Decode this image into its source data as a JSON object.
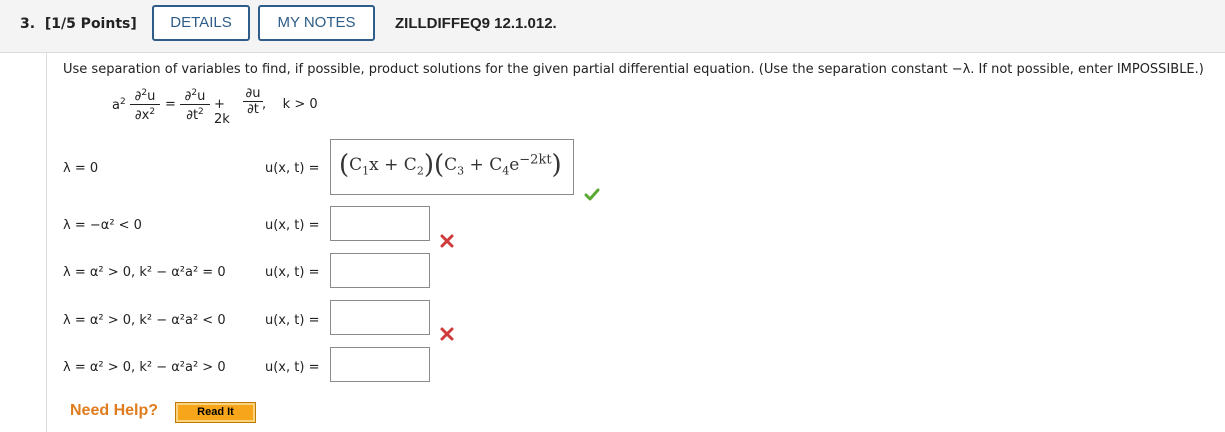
{
  "header": {
    "question_number": "3.",
    "points": "[1/5 Points]",
    "details_label": "DETAILS",
    "notes_label": "MY NOTES",
    "question_id": "ZILLDIFFEQ9 12.1.012."
  },
  "instruction": "Use separation of variables to find, if possible, product solutions for the given partial differential equation. (Use the separation constant −λ. If not possible, enter IMPOSSIBLE.)",
  "pde": {
    "coef": "a",
    "lhs_num": "∂",
    "lhs_u": "u",
    "lhs_den": "∂x",
    "equals": "=",
    "rhs1_num": "∂",
    "rhs1_u": "u",
    "rhs1_den": "∂t",
    "plus_2k": "+ 2k",
    "rhs2_num": "∂u",
    "rhs2_den": "∂t",
    "condition": ",    k > 0"
  },
  "cases": [
    {
      "lambda": "λ = 0",
      "ulabel": "u(x, t) =",
      "answer": "(C₁x + C₂)(C₃ + C₄e⁻²ᵏᵗ)",
      "status": "correct"
    },
    {
      "lambda": "λ = −α² < 0",
      "ulabel": "u(x, t) =",
      "answer": "",
      "status": "incorrect"
    },
    {
      "lambda": "λ = α² > 0, k² − α²a² = 0",
      "ulabel": "u(x, t) =",
      "answer": "",
      "status": "none"
    },
    {
      "lambda": "λ = α² > 0, k² − α²a² < 0",
      "ulabel": "u(x, t) =",
      "answer": "",
      "status": "incorrect"
    },
    {
      "lambda": "λ = α² > 0, k² − α²a² > 0",
      "ulabel": "u(x, t) =",
      "answer": "",
      "status": "none"
    }
  ],
  "help": {
    "need_help": "Need Help?",
    "read_it": "Read It"
  },
  "colors": {
    "header_bg": "#f4f4f4",
    "button_border": "#2d5d88",
    "check_green": "#5aa832",
    "cross_red": "#d03a3a",
    "need_help": "#e07c1d",
    "read_it_bg": "#f7a51b"
  },
  "icons": {
    "correct": "check-icon",
    "incorrect": "x-icon"
  }
}
